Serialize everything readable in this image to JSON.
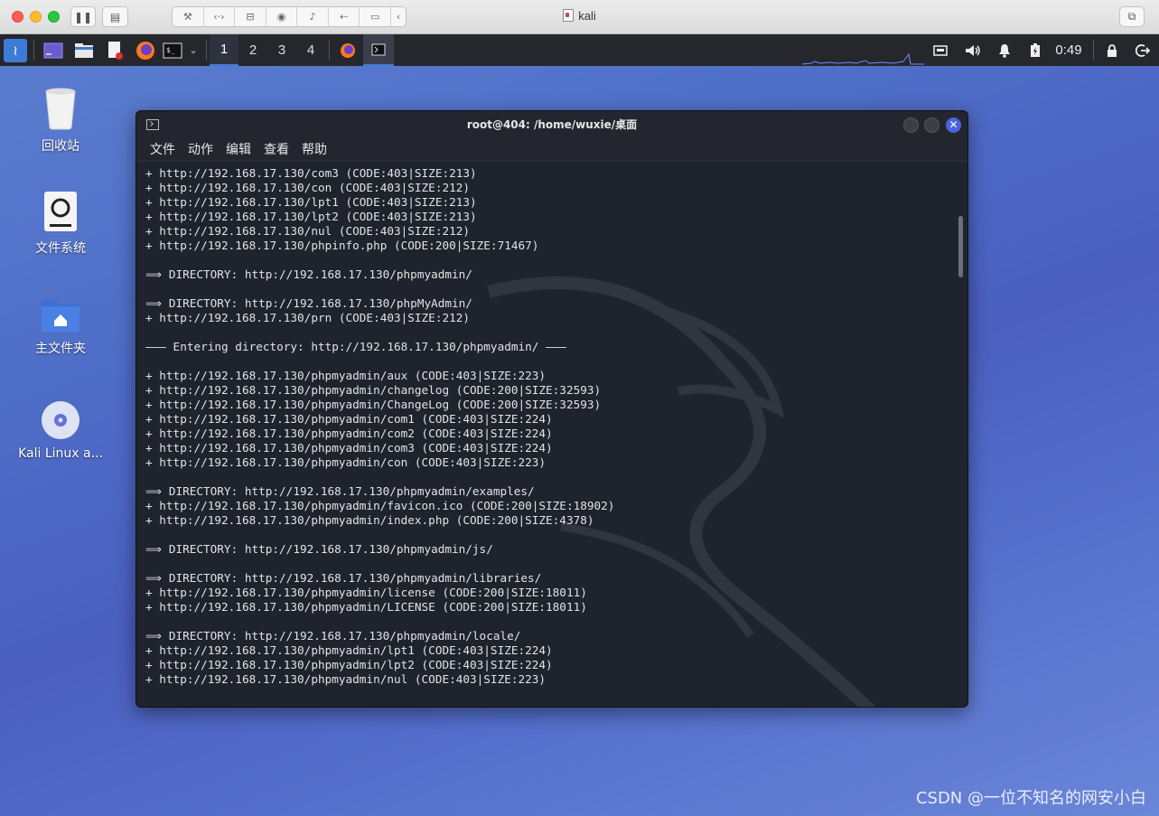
{
  "host": {
    "title": "kali"
  },
  "panel": {
    "workspaces": [
      "1",
      "2",
      "3",
      "4"
    ],
    "active_workspace": "1",
    "clock": "0:49",
    "icons": [
      "kali-menu-icon",
      "show-desktop-icon",
      "file-manager-icon",
      "text-editor-icon",
      "firefox-icon",
      "terminal-icon",
      "network-icon",
      "volume-icon",
      "notification-icon",
      "battery-icon",
      "lock-icon",
      "logout-icon"
    ]
  },
  "desktop": {
    "icons": [
      {
        "label": "回收站",
        "icon": "trash-icon"
      },
      {
        "label": "文件系统",
        "icon": "filesystem-icon"
      },
      {
        "label": "主文件夹",
        "icon": "home-folder-icon"
      },
      {
        "label": "Kali Linux a...",
        "icon": "disc-icon"
      }
    ]
  },
  "terminal": {
    "title": "root@404: /home/wuxie/桌面",
    "menu": [
      "文件",
      "动作",
      "编辑",
      "查看",
      "帮助"
    ],
    "lines": [
      "+ http://192.168.17.130/com3 (CODE:403|SIZE:213)",
      "+ http://192.168.17.130/con (CODE:403|SIZE:212)",
      "+ http://192.168.17.130/lpt1 (CODE:403|SIZE:213)",
      "+ http://192.168.17.130/lpt2 (CODE:403|SIZE:213)",
      "+ http://192.168.17.130/nul (CODE:403|SIZE:212)",
      "+ http://192.168.17.130/phpinfo.php (CODE:200|SIZE:71467)",
      "",
      "⟹ DIRECTORY: http://192.168.17.130/phpmyadmin/",
      "",
      "⟹ DIRECTORY: http://192.168.17.130/phpMyAdmin/",
      "+ http://192.168.17.130/prn (CODE:403|SIZE:212)",
      "",
      "——— Entering directory: http://192.168.17.130/phpmyadmin/ ———",
      "",
      "+ http://192.168.17.130/phpmyadmin/aux (CODE:403|SIZE:223)",
      "+ http://192.168.17.130/phpmyadmin/changelog (CODE:200|SIZE:32593)",
      "+ http://192.168.17.130/phpmyadmin/ChangeLog (CODE:200|SIZE:32593)",
      "+ http://192.168.17.130/phpmyadmin/com1 (CODE:403|SIZE:224)",
      "+ http://192.168.17.130/phpmyadmin/com2 (CODE:403|SIZE:224)",
      "+ http://192.168.17.130/phpmyadmin/com3 (CODE:403|SIZE:224)",
      "+ http://192.168.17.130/phpmyadmin/con (CODE:403|SIZE:223)",
      "",
      "⟹ DIRECTORY: http://192.168.17.130/phpmyadmin/examples/",
      "+ http://192.168.17.130/phpmyadmin/favicon.ico (CODE:200|SIZE:18902)",
      "+ http://192.168.17.130/phpmyadmin/index.php (CODE:200|SIZE:4378)",
      "",
      "⟹ DIRECTORY: http://192.168.17.130/phpmyadmin/js/",
      "",
      "⟹ DIRECTORY: http://192.168.17.130/phpmyadmin/libraries/",
      "+ http://192.168.17.130/phpmyadmin/license (CODE:200|SIZE:18011)",
      "+ http://192.168.17.130/phpmyadmin/LICENSE (CODE:200|SIZE:18011)",
      "",
      "⟹ DIRECTORY: http://192.168.17.130/phpmyadmin/locale/",
      "+ http://192.168.17.130/phpmyadmin/lpt1 (CODE:403|SIZE:224)",
      "+ http://192.168.17.130/phpmyadmin/lpt2 (CODE:403|SIZE:224)",
      "+ http://192.168.17.130/phpmyadmin/nul (CODE:403|SIZE:223)"
    ]
  },
  "watermark": "CSDN @一位不知名的网安小白"
}
